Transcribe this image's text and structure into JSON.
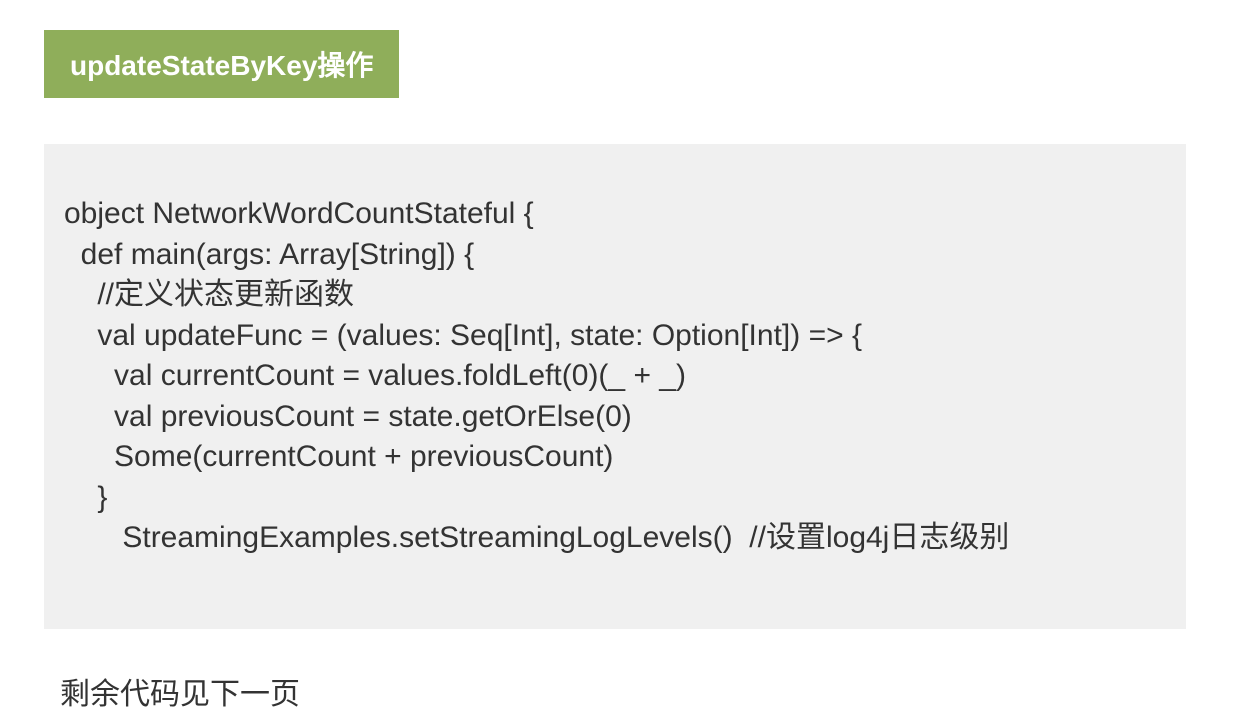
{
  "header": {
    "title": "updateStateByKey操作"
  },
  "code": {
    "lines": [
      "object NetworkWordCountStateful {",
      "  def main(args: Array[String]) {",
      "    //定义状态更新函数",
      "    val updateFunc = (values: Seq[Int], state: Option[Int]) => {",
      "      val currentCount = values.foldLeft(0)(_ + _)",
      "      val previousCount = state.getOrElse(0)",
      "      Some(currentCount + previousCount)",
      "    }",
      "       StreamingExamples.setStreamingLogLevels()  //设置log4j日志级别"
    ]
  },
  "footer": {
    "note": "剩余代码见下一页"
  }
}
